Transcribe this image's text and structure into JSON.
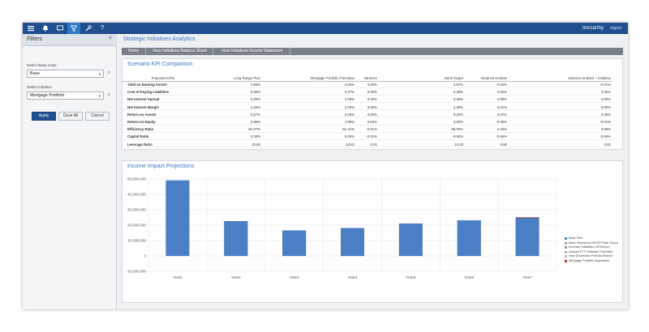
{
  "topbar": {
    "username": "tmccarthy",
    "logout": "logout"
  },
  "filters": {
    "title": "Filters",
    "close_icon": "×",
    "base_case_label": "Select Base Case",
    "base_case_value": "Base",
    "initiative_label": "Select Initiative",
    "initiative_value": "Mortgage Portfolio",
    "apply": "Apply",
    "clear_all": "Clear All",
    "cancel": "Cancel"
  },
  "page": {
    "title": "Strategic Initiatives Analytics",
    "tabs": [
      "Home",
      "View Initiatives Balance Sheet",
      "View Initiatives Income Statement"
    ]
  },
  "kpi": {
    "title": "Scenario KPI Comparison",
    "headers": [
      "Projected KPIs",
      "Long Range Plan",
      "Mortgage Portfolio Purchase",
      "Variance",
      "Bank Target",
      "Variance to Base",
      "Variance to Base + Initiative"
    ],
    "rows": [
      [
        "Yield on Earning Assets",
        "2.65%",
        "2.66%",
        "0.00%",
        "2.67%",
        "-0.02%",
        "-0.01%"
      ],
      [
        "Cost of Paying Liabilities",
        "0.36%",
        "0.37%",
        "0.00%",
        "0.39%",
        "0.02%",
        "0.02%"
      ],
      [
        "Net Interest Spread",
        "2.29%",
        "2.29%",
        "0.00%",
        "0.29%",
        "2.00%",
        "2.00%"
      ],
      [
        "Net Interest Margin",
        "2.29%",
        "2.29%",
        "0.00%",
        "2.28%",
        "0.01%",
        "0.00%"
      ],
      [
        "Return on Assets",
        "0.27%",
        "0.28%",
        "0.00%",
        "0.20%",
        "0.07%",
        "0.08%"
      ],
      [
        "Return on Equity",
        "2.95%",
        "2.99%",
        "0.04%",
        "3.00%",
        "-0.05%",
        "-0.01%"
      ],
      [
        "Efficiency Ratio",
        "81.57%",
        "81.41%",
        "-0.01%",
        "85.00%",
        "3.43%",
        "3.59%"
      ],
      [
        "Capital Ratio",
        "9.26%",
        "9.25%",
        "-0.01%",
        "9.95%",
        "-0.69%",
        "-0.69%"
      ],
      [
        "Leverage Ratio",
        "10.80",
        "10.81",
        "0.01",
        "10.00",
        "0.80",
        "0.81"
      ]
    ]
  },
  "chart_data": {
    "type": "bar",
    "title": "Income Impact Projections",
    "categories": [
      "Year1",
      "Year2",
      "Year3",
      "Year4",
      "Year5",
      "Year6",
      "Year7"
    ],
    "y_ticks": [
      "50,000,000",
      "40,000,000",
      "30,000,000",
      "20,000,000",
      "10,000,000",
      "0",
      "-10,000,000"
    ],
    "ylim": [
      -10000000,
      50000000
    ],
    "series": [
      {
        "name": "Base Plan",
        "color": "#4a7fc6",
        "values": [
          49000000,
          22500000,
          16500000,
          18000000,
          21000000,
          23000000,
          24500000
        ]
      },
      {
        "name": "Base Payments 200 BP Rate Shock",
        "color": "#9aa6b4",
        "values": [
          0,
          0,
          0,
          0,
          0,
          0,
          0
        ]
      },
      {
        "name": "Increase Initiatives Off Branch",
        "color": "#8d99a8",
        "values": [
          0,
          0,
          0,
          0,
          0,
          0,
          0
        ]
      },
      {
        "name": "Acquire ETF Software Purchase",
        "color": "#a8b2be",
        "values": [
          0,
          0,
          0,
          0,
          0,
          0,
          0
        ]
      },
      {
        "name": "New Downtown Portfolio Branch",
        "color": "#b4bdc8",
        "values": [
          0,
          0,
          0,
          0,
          0,
          0,
          0
        ]
      },
      {
        "name": "Mortgage Portfolio Acquisition",
        "color": "#c0392b",
        "values": [
          0,
          0,
          0,
          0,
          0,
          0,
          500000
        ]
      }
    ],
    "grid": true,
    "legend_position": "right"
  }
}
